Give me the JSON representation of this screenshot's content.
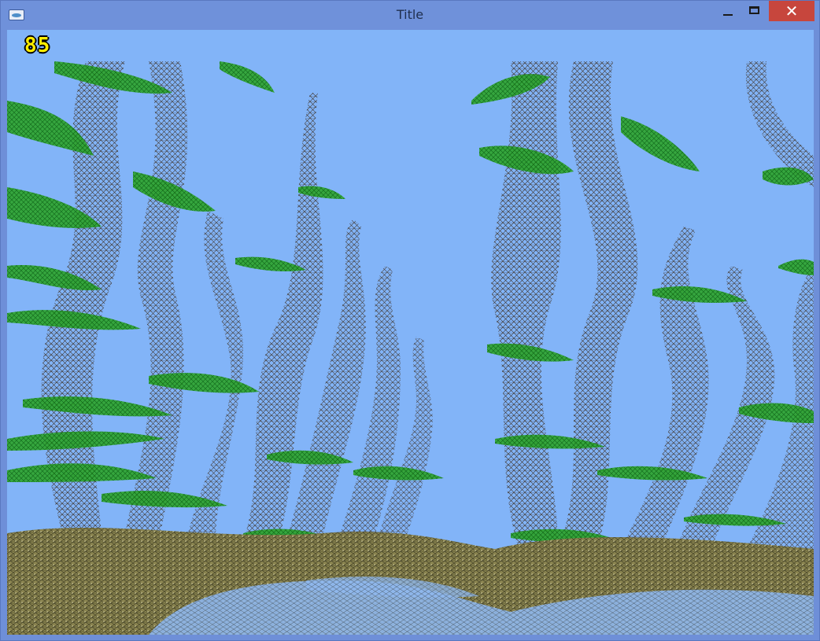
{
  "window": {
    "title": "Title",
    "close_glyph": "✕"
  },
  "hud": {
    "fps_counter": "85"
  },
  "scene": {
    "description_icon": "3d-wireframe-forest",
    "sky_color": "#82b4f8",
    "leaf_color": "#19a619",
    "trunk_color": "#5a4a32",
    "ground_color": "#8a8450"
  }
}
